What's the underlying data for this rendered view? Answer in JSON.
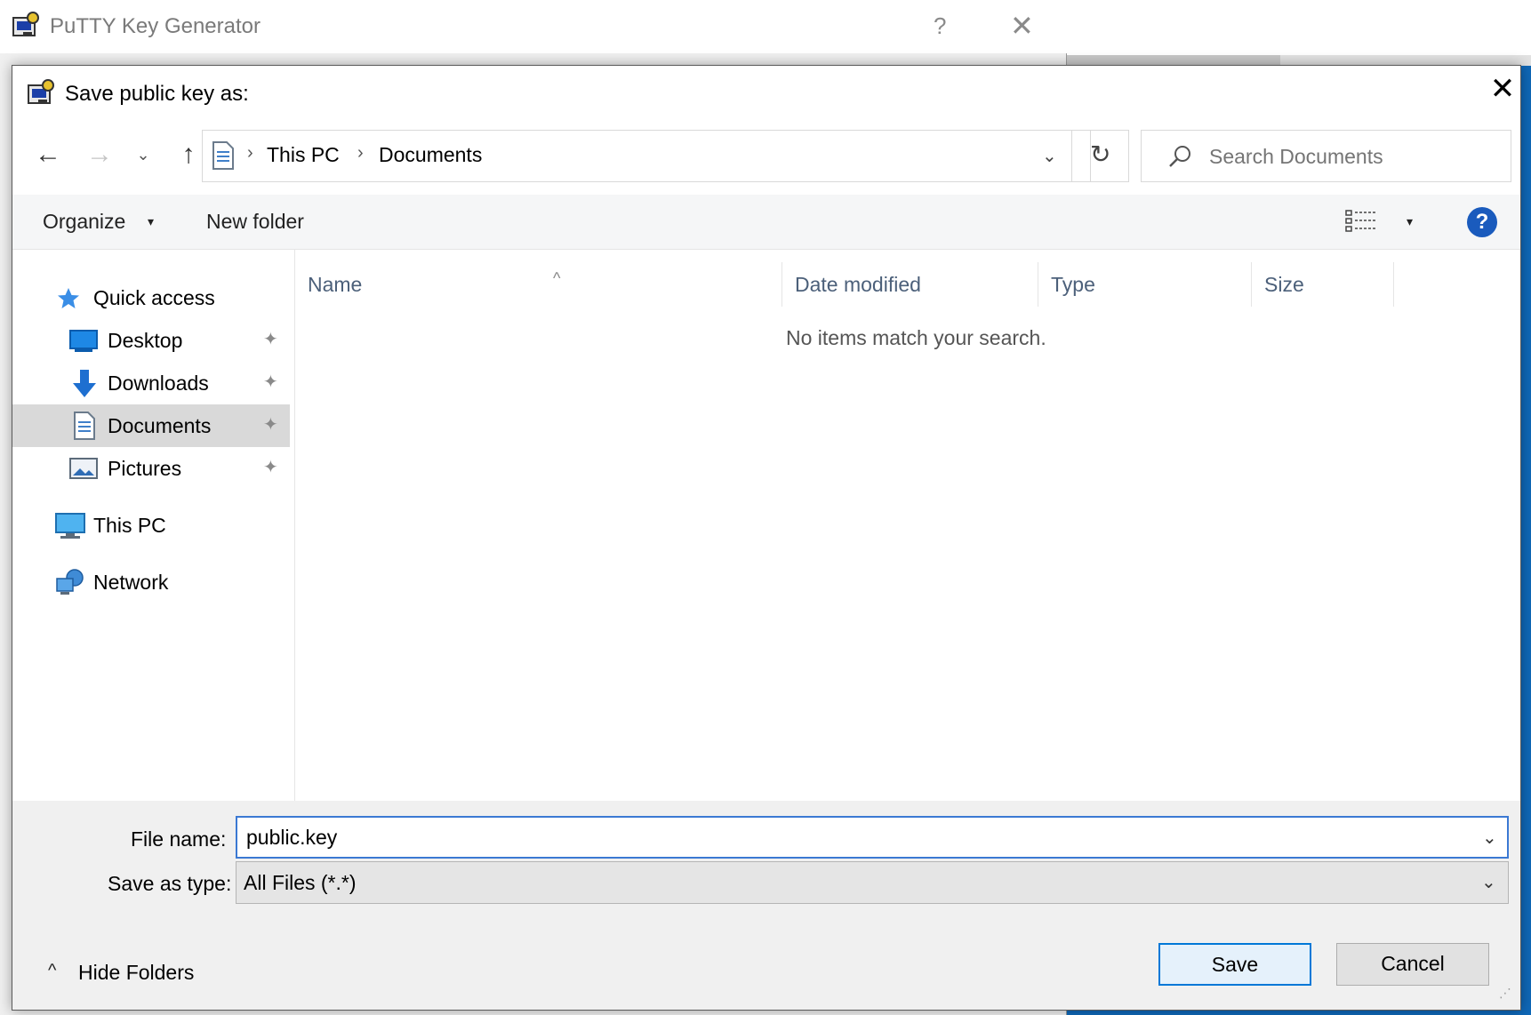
{
  "background_window": {
    "title": "PuTTY Key Generator",
    "help_glyph": "?",
    "close_glyph": "✕"
  },
  "dialog": {
    "title": "Save public key as:",
    "close_glyph": "✕",
    "icon": "putty-keygen-icon"
  },
  "navigation": {
    "back_glyph": "←",
    "forward_glyph": "→",
    "recent_glyph": "⌄",
    "up_glyph": "↑",
    "breadcrumb": [
      "This PC",
      "Documents"
    ],
    "breadcrumb_separator": "›",
    "dropdown_glyph": "⌄",
    "refresh_glyph": "↻"
  },
  "search": {
    "placeholder": "Search Documents"
  },
  "toolbar": {
    "organize_label": "Organize",
    "new_folder_label": "New folder",
    "caret_glyph": "▾",
    "help_glyph": "?"
  },
  "nav_pane": {
    "items": [
      {
        "label": "Quick access",
        "icon": "star-icon",
        "pinned": false
      },
      {
        "label": "Desktop",
        "icon": "desktop-icon",
        "pinned": true
      },
      {
        "label": "Downloads",
        "icon": "download-icon",
        "pinned": true
      },
      {
        "label": "Documents",
        "icon": "document-icon",
        "pinned": true,
        "selected": true
      },
      {
        "label": "Pictures",
        "icon": "pictures-icon",
        "pinned": true
      },
      {
        "label": "This PC",
        "icon": "computer-icon",
        "pinned": false
      },
      {
        "label": "Network",
        "icon": "network-icon",
        "pinned": false
      }
    ],
    "pin_glyph": "📌"
  },
  "file_list": {
    "columns": [
      "Name",
      "Date modified",
      "Type",
      "Size"
    ],
    "sort_glyph": "^",
    "empty_message": "No items match your search."
  },
  "form": {
    "filename_label": "File name:",
    "filename_value": "public.key",
    "savetype_label": "Save as type:",
    "savetype_value": "All Files (*.*)",
    "dropdown_glyph": "⌄"
  },
  "footer": {
    "hide_folders_label": "Hide Folders",
    "hide_caret_glyph": "^",
    "save_label": "Save",
    "cancel_label": "Cancel"
  },
  "colors": {
    "accent": "#0078d7",
    "desktop_background": "#0f68b8",
    "selected_nav": "#d9d9d9",
    "help_badge": "#1a5bbd"
  }
}
